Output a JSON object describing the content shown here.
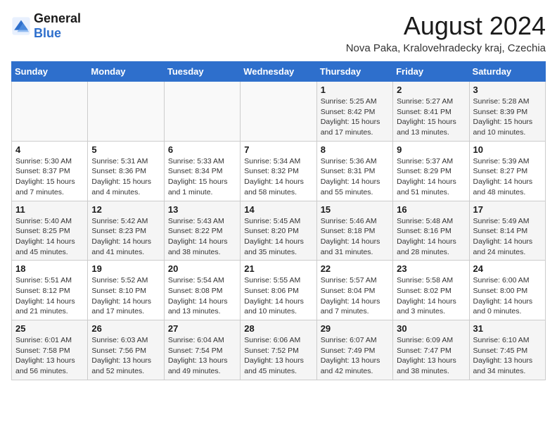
{
  "logo": {
    "line1": "General",
    "line2": "Blue"
  },
  "title": "August 2024",
  "location": "Nova Paka, Kralovehradecky kraj, Czechia",
  "weekdays": [
    "Sunday",
    "Monday",
    "Tuesday",
    "Wednesday",
    "Thursday",
    "Friday",
    "Saturday"
  ],
  "weeks": [
    [
      {
        "day": "",
        "info": ""
      },
      {
        "day": "",
        "info": ""
      },
      {
        "day": "",
        "info": ""
      },
      {
        "day": "",
        "info": ""
      },
      {
        "day": "1",
        "info": "Sunrise: 5:25 AM\nSunset: 8:42 PM\nDaylight: 15 hours and 17 minutes."
      },
      {
        "day": "2",
        "info": "Sunrise: 5:27 AM\nSunset: 8:41 PM\nDaylight: 15 hours and 13 minutes."
      },
      {
        "day": "3",
        "info": "Sunrise: 5:28 AM\nSunset: 8:39 PM\nDaylight: 15 hours and 10 minutes."
      }
    ],
    [
      {
        "day": "4",
        "info": "Sunrise: 5:30 AM\nSunset: 8:37 PM\nDaylight: 15 hours and 7 minutes."
      },
      {
        "day": "5",
        "info": "Sunrise: 5:31 AM\nSunset: 8:36 PM\nDaylight: 15 hours and 4 minutes."
      },
      {
        "day": "6",
        "info": "Sunrise: 5:33 AM\nSunset: 8:34 PM\nDaylight: 15 hours and 1 minute."
      },
      {
        "day": "7",
        "info": "Sunrise: 5:34 AM\nSunset: 8:32 PM\nDaylight: 14 hours and 58 minutes."
      },
      {
        "day": "8",
        "info": "Sunrise: 5:36 AM\nSunset: 8:31 PM\nDaylight: 14 hours and 55 minutes."
      },
      {
        "day": "9",
        "info": "Sunrise: 5:37 AM\nSunset: 8:29 PM\nDaylight: 14 hours and 51 minutes."
      },
      {
        "day": "10",
        "info": "Sunrise: 5:39 AM\nSunset: 8:27 PM\nDaylight: 14 hours and 48 minutes."
      }
    ],
    [
      {
        "day": "11",
        "info": "Sunrise: 5:40 AM\nSunset: 8:25 PM\nDaylight: 14 hours and 45 minutes."
      },
      {
        "day": "12",
        "info": "Sunrise: 5:42 AM\nSunset: 8:23 PM\nDaylight: 14 hours and 41 minutes."
      },
      {
        "day": "13",
        "info": "Sunrise: 5:43 AM\nSunset: 8:22 PM\nDaylight: 14 hours and 38 minutes."
      },
      {
        "day": "14",
        "info": "Sunrise: 5:45 AM\nSunset: 8:20 PM\nDaylight: 14 hours and 35 minutes."
      },
      {
        "day": "15",
        "info": "Sunrise: 5:46 AM\nSunset: 8:18 PM\nDaylight: 14 hours and 31 minutes."
      },
      {
        "day": "16",
        "info": "Sunrise: 5:48 AM\nSunset: 8:16 PM\nDaylight: 14 hours and 28 minutes."
      },
      {
        "day": "17",
        "info": "Sunrise: 5:49 AM\nSunset: 8:14 PM\nDaylight: 14 hours and 24 minutes."
      }
    ],
    [
      {
        "day": "18",
        "info": "Sunrise: 5:51 AM\nSunset: 8:12 PM\nDaylight: 14 hours and 21 minutes."
      },
      {
        "day": "19",
        "info": "Sunrise: 5:52 AM\nSunset: 8:10 PM\nDaylight: 14 hours and 17 minutes."
      },
      {
        "day": "20",
        "info": "Sunrise: 5:54 AM\nSunset: 8:08 PM\nDaylight: 14 hours and 13 minutes."
      },
      {
        "day": "21",
        "info": "Sunrise: 5:55 AM\nSunset: 8:06 PM\nDaylight: 14 hours and 10 minutes."
      },
      {
        "day": "22",
        "info": "Sunrise: 5:57 AM\nSunset: 8:04 PM\nDaylight: 14 hours and 7 minutes."
      },
      {
        "day": "23",
        "info": "Sunrise: 5:58 AM\nSunset: 8:02 PM\nDaylight: 14 hours and 3 minutes."
      },
      {
        "day": "24",
        "info": "Sunrise: 6:00 AM\nSunset: 8:00 PM\nDaylight: 14 hours and 0 minutes."
      }
    ],
    [
      {
        "day": "25",
        "info": "Sunrise: 6:01 AM\nSunset: 7:58 PM\nDaylight: 13 hours and 56 minutes."
      },
      {
        "day": "26",
        "info": "Sunrise: 6:03 AM\nSunset: 7:56 PM\nDaylight: 13 hours and 52 minutes."
      },
      {
        "day": "27",
        "info": "Sunrise: 6:04 AM\nSunset: 7:54 PM\nDaylight: 13 hours and 49 minutes."
      },
      {
        "day": "28",
        "info": "Sunrise: 6:06 AM\nSunset: 7:52 PM\nDaylight: 13 hours and 45 minutes."
      },
      {
        "day": "29",
        "info": "Sunrise: 6:07 AM\nSunset: 7:49 PM\nDaylight: 13 hours and 42 minutes."
      },
      {
        "day": "30",
        "info": "Sunrise: 6:09 AM\nSunset: 7:47 PM\nDaylight: 13 hours and 38 minutes."
      },
      {
        "day": "31",
        "info": "Sunrise: 6:10 AM\nSunset: 7:45 PM\nDaylight: 13 hours and 34 minutes."
      }
    ]
  ]
}
